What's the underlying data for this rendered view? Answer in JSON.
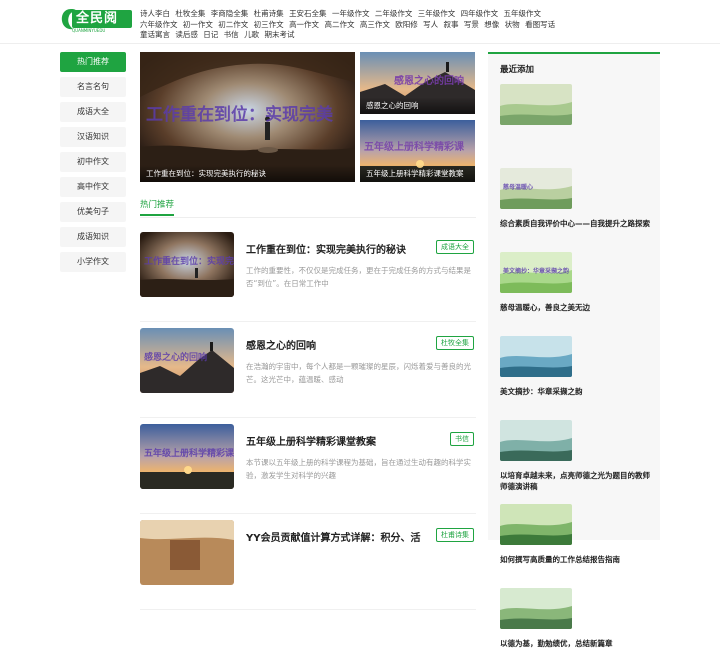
{
  "logo": {
    "text": "全民阅读",
    "sub": "QUANMINYUEDU"
  },
  "topnav": [
    "诗人李白",
    "杜牧全集",
    "李商隐全集",
    "杜甫诗集",
    "王安石全集",
    "一年级作文",
    "二年级作文",
    "三年级作文",
    "四年级作文",
    "五年级作文",
    "六年级作文",
    "初一作文",
    "初二作文",
    "初三作文",
    "高一作文",
    "高二作文",
    "高三作文",
    "欧阳修",
    "写人",
    "叙事",
    "写景",
    "想像",
    "状物",
    "看图写话",
    "童话寓言",
    "读后感",
    "日记",
    "书信",
    "儿歌",
    "期末考试"
  ],
  "sidebar": [
    "热门推荐",
    "名言名句",
    "成语大全",
    "汉语知识",
    "初中作文",
    "高中作文",
    "优美句子",
    "成语知识",
    "小学作文"
  ],
  "hero": {
    "big": {
      "caption": "工作重在到位：实现完美执行的秘诀",
      "overlay": "工作重在到位：实现完美"
    },
    "small1": {
      "caption": "感恩之心的回响",
      "overlay": "感恩之心的回响"
    },
    "small2": {
      "caption": "五年级上册科学精彩课堂教案",
      "overlay": "五年级上册科学精彩课"
    }
  },
  "tab_label": "热门推荐",
  "articles": [
    {
      "title": "工作重在到位：实现完美执行的秘诀",
      "tag": "成语大全",
      "desc": "工作的重要性，不仅仅是完成任务，更在于完成任务的方式与结果是否“到位”。在日常工作中",
      "overlay": "工作重在到位：实现完"
    },
    {
      "title": "感恩之心的回响",
      "tag": "杜牧全集",
      "desc": "在浩瀚的宇宙中，每个人都是一颗璀璨的星辰，闪烁着爱与善良的光芒。这光芒中，蕴温暖、感动",
      "overlay": "感恩之心的回响"
    },
    {
      "title": "五年级上册科学精彩课堂教案",
      "tag": "书信",
      "desc": "本节课以五年级上册的科学课程为基础，旨在通过生动有趣的科学实验，激发学生对科学的兴趣",
      "overlay": "五年级上册科学精彩课"
    },
    {
      "title": "YY会员贡献值计算方式详解：积分、活",
      "tag": "杜甫诗集",
      "desc": "",
      "overlay": ""
    }
  ],
  "recent": {
    "title": "最近添加",
    "items": [
      {
        "text": "",
        "overlay": ""
      },
      {
        "text": "综合素质自我评价中心——自我提升之路探索",
        "overlay": "慈母温暖心"
      },
      {
        "text": "慈母温暖心，善良之美无边",
        "overlay": "美文摘抄：华章采撷之韵"
      },
      {
        "text": "美文摘抄：华章采撷之韵",
        "overlay": ""
      },
      {
        "text": "以培育卓越未来，点亮师德之光为题目的教师师德演讲稿",
        "overlay": ""
      },
      {
        "text": "如何撰写高质量的工作总结报告指南",
        "overlay": ""
      },
      {
        "text": "以德为基，勤勉绩优，总结新篇章",
        "overlay": ""
      }
    ]
  }
}
